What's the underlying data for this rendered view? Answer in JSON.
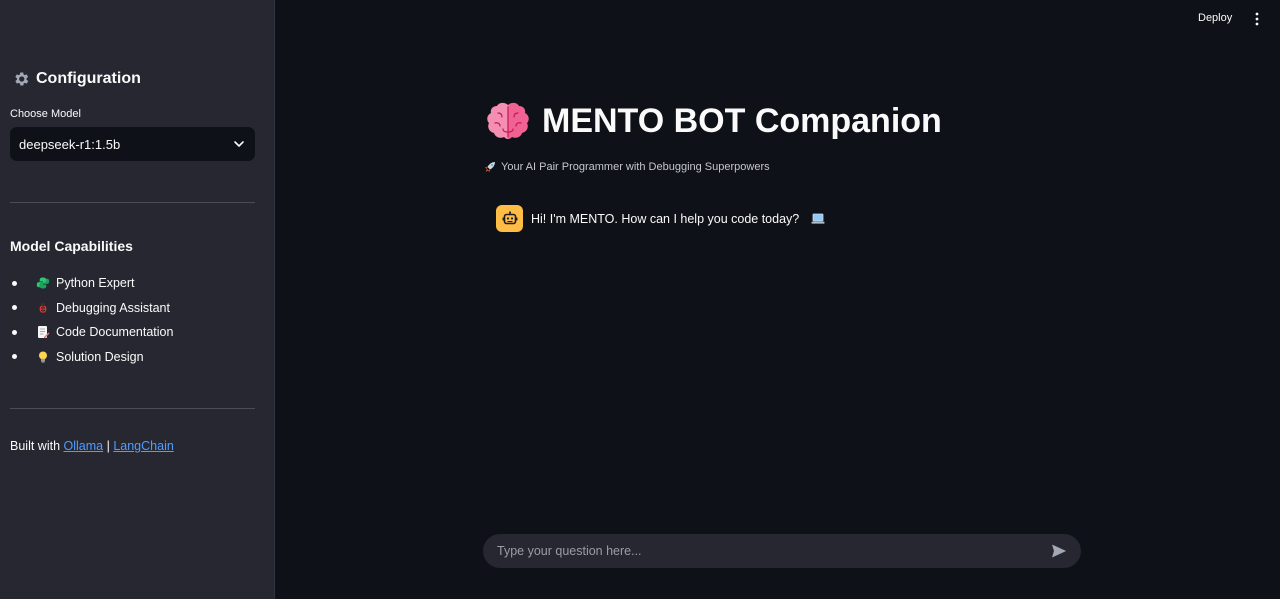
{
  "header": {
    "deploy_label": "Deploy",
    "menu_icon": "kebab-menu-icon"
  },
  "sidebar": {
    "config_title": "Configuration",
    "config_icon": "gear-icon",
    "model_label": "Choose Model",
    "model_selected": "deepseek-r1:1.5b",
    "capabilities_title": "Model Capabilities",
    "capabilities": [
      {
        "icon": "python-icon",
        "label": "Python Expert"
      },
      {
        "icon": "bug-icon",
        "label": "Debugging Assistant"
      },
      {
        "icon": "memo-icon",
        "label": "Code Documentation"
      },
      {
        "icon": "lightbulb-icon",
        "label": "Solution Design"
      }
    ],
    "built_with_text": "Built with",
    "built_links": [
      "Ollama",
      "LangChain"
    ],
    "built_separator": "|"
  },
  "main": {
    "title": "MENTO BOT Companion",
    "title_icon": "brain-icon",
    "subtitle": "Your AI Pair Programmer with Debugging Superpowers",
    "subtitle_icon": "rocket-icon",
    "messages": [
      {
        "role": "assistant",
        "avatar_icon": "robot-icon",
        "text": "Hi! I'm MENTO. How can I help you code today?",
        "trailing_icon": "laptop-icon"
      }
    ],
    "input_placeholder": "Type your question here...",
    "send_icon": "send-icon"
  },
  "colors": {
    "background": "#0e1117",
    "sidebar": "#262730",
    "accent_link": "#4f9dff",
    "avatar": "#ffbd45",
    "brain": "#f48fb1"
  }
}
